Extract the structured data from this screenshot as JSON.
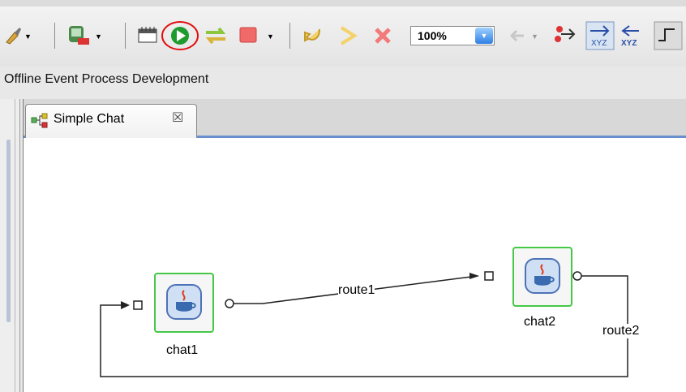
{
  "toolbar": {
    "zoom_value": "100%",
    "icons": [
      "brush-icon",
      "deploy-icon",
      "calendar-icon",
      "run-icon",
      "refresh-icon",
      "stop-icon",
      "undo-icon",
      "redo-icon",
      "delete-icon",
      "zoom-dropdown",
      "back-icon",
      "network-icon",
      "xyz-arrow-icon",
      "xyz-split-icon",
      "connector-icon"
    ]
  },
  "perspective": {
    "title": "Offline Event Process Development"
  },
  "editor": {
    "tab_label": "Simple Chat",
    "tab_close": "☒"
  },
  "diagram": {
    "nodes": [
      {
        "label": "chat1"
      },
      {
        "label": "chat2"
      }
    ],
    "edges": [
      {
        "label": "route1"
      },
      {
        "label": "route2"
      }
    ]
  },
  "colors": {
    "node_border": "#45c845",
    "run_highlight": "#e01010",
    "run_green": "#1f9a2e",
    "tab_underline": "#6a8fce"
  }
}
